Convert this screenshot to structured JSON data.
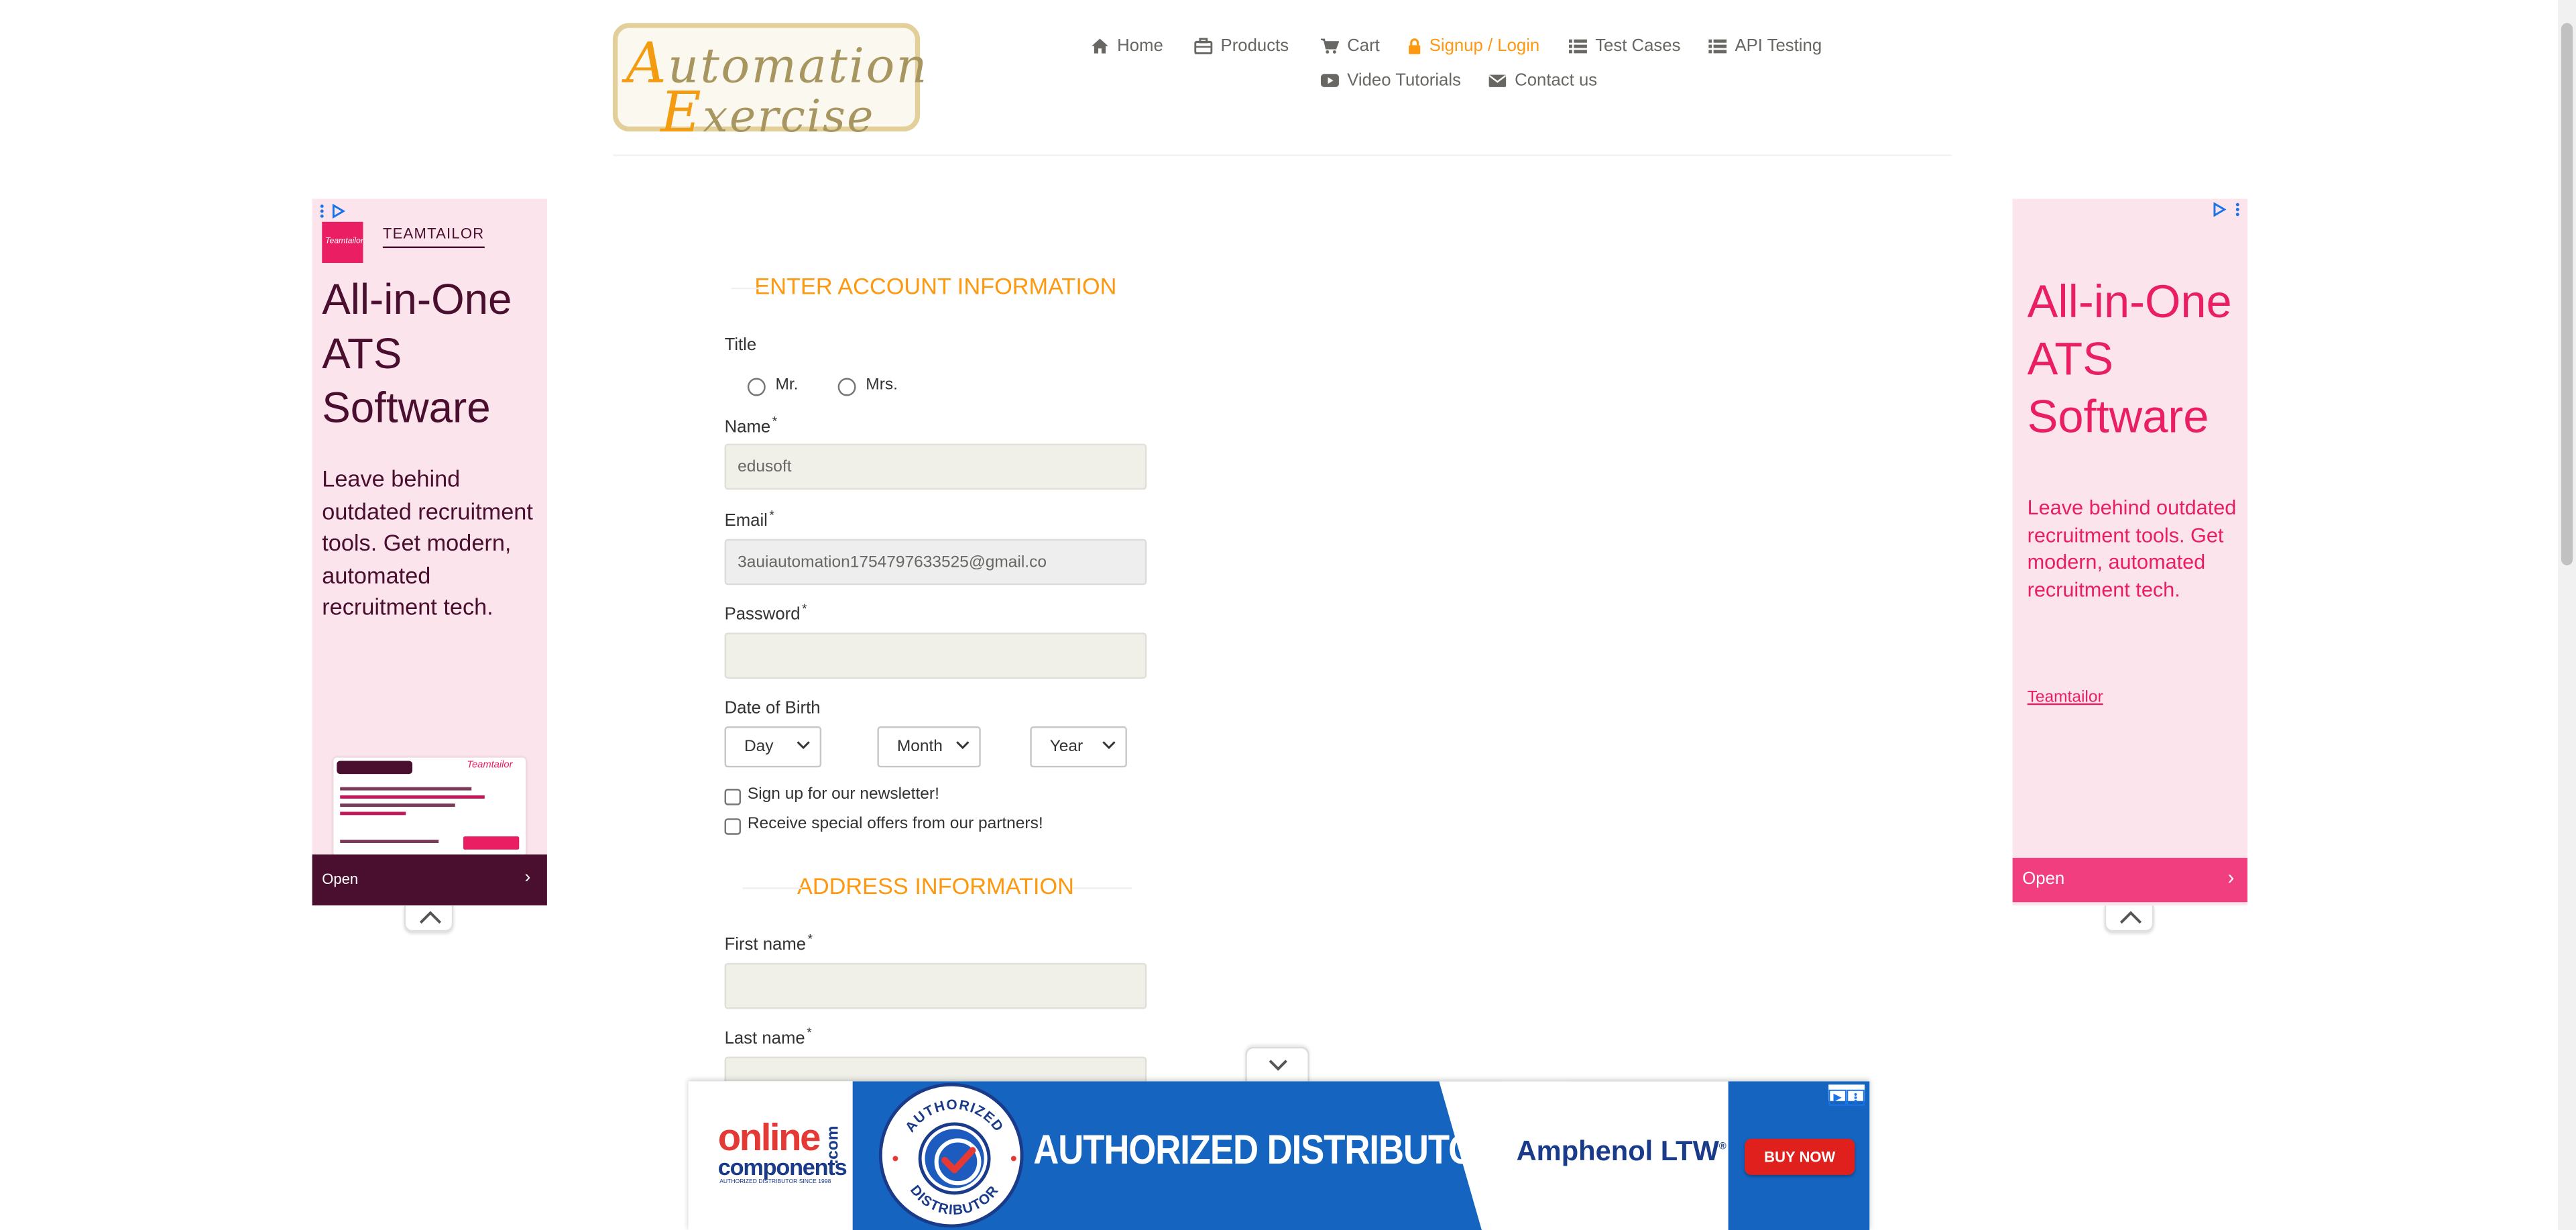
{
  "logo": {
    "line1_cap": "A",
    "line1_rest": "utomation",
    "line2_cap": "E",
    "line2_rest": "xercise"
  },
  "nav": {
    "items": [
      {
        "label": "Home",
        "icon": "home-icon"
      },
      {
        "label": "Products",
        "icon": "products-icon"
      },
      {
        "label": "Cart",
        "icon": "cart-icon"
      },
      {
        "label": "Signup / Login",
        "icon": "lock-icon",
        "active": true
      },
      {
        "label": "Test Cases",
        "icon": "list-icon"
      },
      {
        "label": "API Testing",
        "icon": "list-icon"
      },
      {
        "label": "Video Tutorials",
        "icon": "youtube-play-icon"
      },
      {
        "label": "Contact us",
        "icon": "envelope-icon"
      }
    ]
  },
  "form": {
    "account_title": "ENTER ACCOUNT INFORMATION",
    "title_label": "Title",
    "title_options": [
      "Mr.",
      "Mrs."
    ],
    "name_label": "Name",
    "name_value": "edusoft",
    "email_label": "Email",
    "email_value": "3auiautomation1754797633525@gmail.co",
    "password_label": "Password",
    "password_value": "",
    "required_mark": "*",
    "dob_label": "Date of Birth",
    "dob_day": "Day",
    "dob_month": "Month",
    "dob_year": "Year",
    "newsletter_label": "Sign up for our newsletter!",
    "offers_label": "Receive special offers from our partners!",
    "address_title": "ADDRESS INFORMATION",
    "first_name_label": "First name",
    "last_name_label": "Last name"
  },
  "ad_left": {
    "brand": "TEAMTAILOR",
    "brand_mark": "Teamtailor",
    "headline": "All-in-One ATS Software",
    "body": "Leave behind outdated recruitment tools. Get modern, automated recruitment tech.",
    "open_label": "Open"
  },
  "ad_right": {
    "headline": "All-in-One ATS Software",
    "body": "Leave behind outdated recruitment tools. Get modern, automated recruitment tech.",
    "link": "Teamtailor",
    "open_label": "Open"
  },
  "ad_bottom": {
    "oc_top": "online",
    "oc_bottom": "components",
    "oc_dot": ".com",
    "oc_tagline": "AUTHORIZED DISTRIBUTOR SINCE 1998",
    "badge_top": "AUTHORIZED",
    "badge_bottom": "DISTRIBUTOR",
    "headline": "AUTHORIZED DISTRIBUTOR",
    "brand": "Amphenol LTW",
    "brand_tm": "®",
    "cta": "BUY NOW"
  },
  "colors": {
    "accent": "#fe980f",
    "nav_text": "#696763",
    "input_bg": "#f0f0e9",
    "teamtailor_dark": "#4a0e2e",
    "teamtailor_pink": "#e91e63",
    "ad_pink_bg": "#fce4ec",
    "banner_blue": "#1565c0",
    "cta_red": "#e0201c"
  }
}
